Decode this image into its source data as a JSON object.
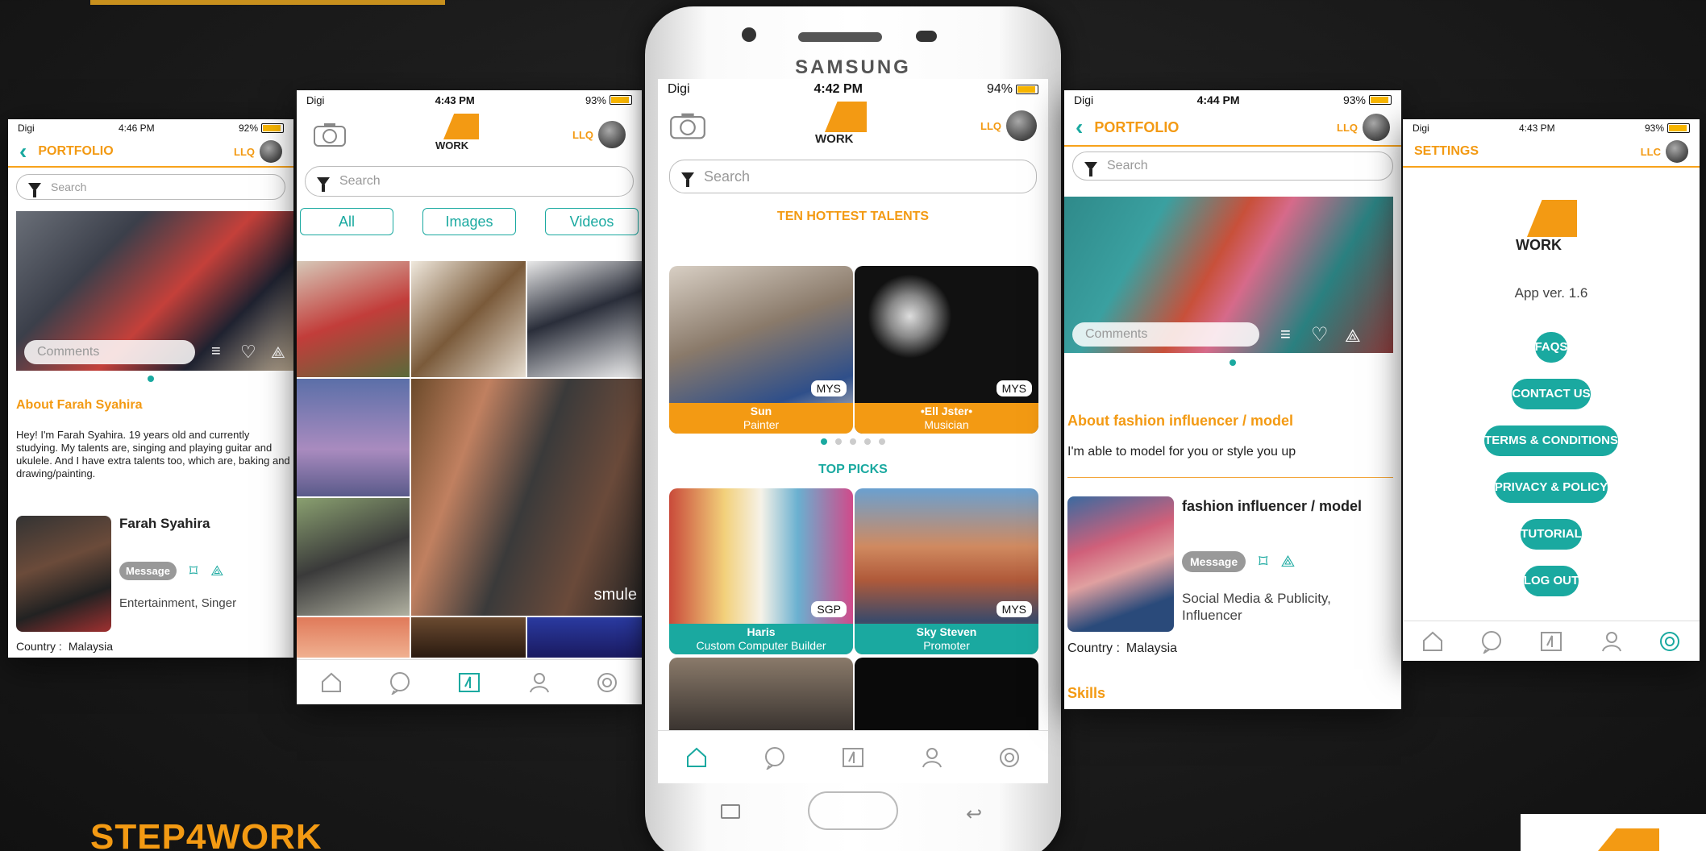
{
  "brand": {
    "name": "STEP4WORK"
  },
  "logo": {
    "text": "WORK",
    "accent": "#f39a13"
  },
  "colors": {
    "teal": "#1aa9a0",
    "orange": "#f39a13"
  },
  "phone": {
    "maker": "SAMSUNG"
  },
  "center": {
    "status": {
      "carrier": "Digi",
      "time": "4:42 PM",
      "battery": "94%"
    },
    "user_label": "LLQ",
    "search_placeholder": "Search",
    "section1": "TEN HOTTEST TALENTS",
    "section2": "TOP PICKS",
    "talents": [
      {
        "name": "Sun",
        "role": "Painter",
        "country": "MYS"
      },
      {
        "name": "•Ell Jster•",
        "role": "Musician",
        "country": "MYS"
      }
    ],
    "picks": [
      {
        "name": "Haris",
        "role": "Custom Computer Builder",
        "country": "SGP"
      },
      {
        "name": "Sky Steven",
        "role": "Promoter",
        "country": "MYS"
      }
    ]
  },
  "left": {
    "status": {
      "carrier": "Digi",
      "time": "4:46 PM",
      "battery": "92%"
    },
    "title": "PORTFOLIO",
    "user_label": "LLQ",
    "search_placeholder": "Search",
    "comment_placeholder": "Comments",
    "about_title": "About Farah Syahira",
    "about_text": "Hey! I'm Farah Syahira. 19 years old and currently studying. My talents are, singing and playing guitar and ukulele. And I have extra talents too, which are, baking and drawing/painting.",
    "profile_name": "Farah Syahira",
    "message_label": "Message",
    "categories": "Entertainment, Singer",
    "country_label": "Country :",
    "country": "Malaysia"
  },
  "gallery": {
    "status": {
      "carrier": "Digi",
      "time": "4:43 PM",
      "battery": "93%"
    },
    "user_label": "LLQ",
    "search_placeholder": "Search",
    "tabs": [
      "All",
      "Images",
      "Videos"
    ],
    "watermark": "smule"
  },
  "right": {
    "status": {
      "carrier": "Digi",
      "time": "4:44 PM",
      "battery": "93%"
    },
    "title": "PORTFOLIO",
    "user_label": "LLQ",
    "search_placeholder": "Search",
    "comment_placeholder": "Comments",
    "about_title": "About fashion influencer / model",
    "about_text": "I'm able to model for you or style you up",
    "profile_name": "fashion influencer / model",
    "message_label": "Message",
    "categories": "Social Media & Publicity, Influencer",
    "country_label": "Country :",
    "country": "Malaysia",
    "skills_title": "Skills"
  },
  "settings": {
    "status": {
      "carrier": "Digi",
      "time": "4:43 PM",
      "battery": "93%"
    },
    "title": "SETTINGS",
    "user_label": "LLC",
    "version": "App ver. 1.6",
    "buttons": [
      "FAQS",
      "CONTACT US",
      "TERMS & CONDITIONS",
      "PRIVACY & POLICY",
      "TUTORIAL",
      "LOG OUT"
    ]
  }
}
